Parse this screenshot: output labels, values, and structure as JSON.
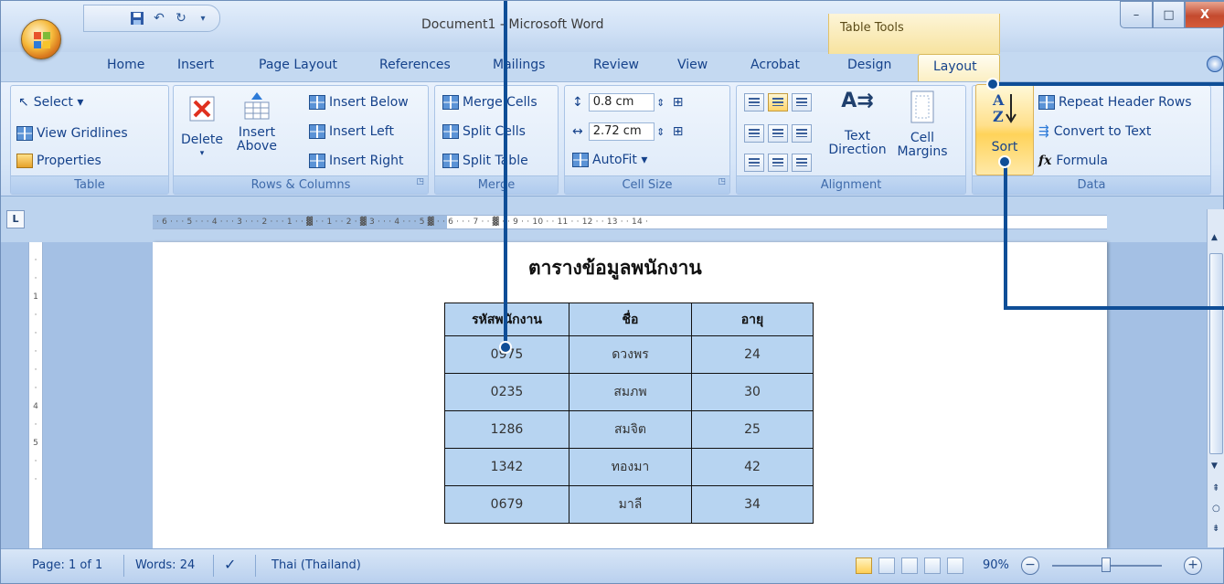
{
  "window": {
    "title": "Document1 - Microsoft Word",
    "contextual_group": "Table Tools",
    "controls": {
      "minimize": "–",
      "maximize": "□",
      "close": "X"
    }
  },
  "quick_access": {
    "items": [
      "save-icon",
      "undo-icon",
      "redo-icon",
      "customize-icon"
    ]
  },
  "tabs": [
    "Home",
    "Insert",
    "Page Layout",
    "References",
    "Mailings",
    "Review",
    "View",
    "Acrobat",
    "Design",
    "Layout"
  ],
  "active_tab": "Layout",
  "ribbon": {
    "table": {
      "label": "Table",
      "select": "Select ▾",
      "view_gridlines": "View Gridlines",
      "properties": "Properties"
    },
    "rows_columns": {
      "label": "Rows & Columns",
      "delete": "Delete",
      "delete_arrow": "▾",
      "insert_above_1": "Insert",
      "insert_above_2": "Above",
      "insert_below": "Insert Below",
      "insert_left": "Insert Left",
      "insert_right": "Insert Right"
    },
    "merge": {
      "label": "Merge",
      "merge_cells": "Merge Cells",
      "split_cells": "Split Cells",
      "split_table": "Split Table"
    },
    "cell_size": {
      "label": "Cell Size",
      "height": "0.8 cm",
      "width": "2.72 cm",
      "autofit": "AutoFit ▾"
    },
    "alignment": {
      "label": "Alignment",
      "text_direction_1": "Text",
      "text_direction_2": "Direction",
      "cell_margins_1": "Cell",
      "cell_margins_2": "Margins"
    },
    "data": {
      "label": "Data",
      "sort": "Sort",
      "repeat_header_rows": "Repeat Header Rows",
      "convert_to_text": "Convert to Text",
      "formula": "Formula"
    }
  },
  "ruler": {
    "corner": "L",
    "marks": "· 6 · · · 5 · · · 4 · · · 3 · · · 2 · · · 1 · · ▓ · · 1 · · 2 · ▓ 3 · · · 4 · · · 5 ▓ · · 6 · · · 7 · · ▓ · · 9 · · 10 · · 11 · · 12 · · 13 · · 14 ·",
    "vertical_marks": [
      "·",
      "·",
      "1",
      "·",
      "·",
      "·",
      "·",
      "·",
      "4",
      "·",
      "5",
      "·",
      "·"
    ]
  },
  "document": {
    "title": "ตารางข้อมูลพนักงาน",
    "table": {
      "headers": [
        "รหัสพนักงาน",
        "ชื่อ",
        "อายุ"
      ],
      "rows": [
        [
          "0975",
          "ดวงพร",
          "24"
        ],
        [
          "0235",
          "สมภพ",
          "30"
        ],
        [
          "1286",
          "สมจิต",
          "25"
        ],
        [
          "1342",
          "ทองมา",
          "42"
        ],
        [
          "0679",
          "มาลี",
          "34"
        ]
      ]
    }
  },
  "status_bar": {
    "page": "Page: 1 of 1",
    "words": "Words: 24",
    "language": "Thai (Thailand)",
    "zoom": "90%",
    "zoom_minus": "−",
    "zoom_plus": "+"
  },
  "colors": {
    "accent": "#0f4e97",
    "table_fill": "#b7d4f1",
    "ribbon_bg": "#dde9f8"
  }
}
